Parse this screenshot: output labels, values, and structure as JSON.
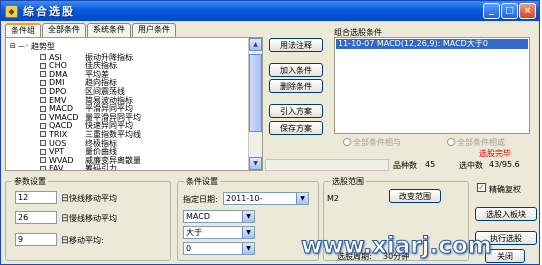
{
  "window": {
    "title": "综合选股",
    "min": "_",
    "max": "□",
    "close": "×"
  },
  "tabs": [
    "条件组",
    "全部条件",
    "系统条件",
    "用户条件"
  ],
  "tree": {
    "root": "趋势型",
    "items": [
      {
        "code": "ASI",
        "name": "振动升降指标"
      },
      {
        "code": "CHO",
        "name": "佳庆指标"
      },
      {
        "code": "DMA",
        "name": "平均差"
      },
      {
        "code": "DMI",
        "name": "趋向指标"
      },
      {
        "code": "DPO",
        "name": "区间震荡线"
      },
      {
        "code": "EMV",
        "name": "简易波动指标"
      },
      {
        "code": "MACD",
        "name": "平滑异同平均"
      },
      {
        "code": "VMACD",
        "name": "量平滑异同平均"
      },
      {
        "code": "QACD",
        "name": "快速异同平均"
      },
      {
        "code": "TRIX",
        "name": "三重指数平均线"
      },
      {
        "code": "UOS",
        "name": "终极指标"
      },
      {
        "code": "VPT",
        "name": "量价曲线"
      },
      {
        "code": "WVAD",
        "name": "威廉变异离散量"
      },
      {
        "code": "FAV",
        "name": "筹码引力"
      }
    ]
  },
  "buttons": {
    "help": "用法注释",
    "add": "加入条件",
    "delete": "删除条件",
    "import": "引入方案",
    "save": "保存方案",
    "modify_range": "改变范围",
    "add_to_block": "选股入板块",
    "execute": "执行选股",
    "close": "关闭"
  },
  "combo": {
    "title": "组合选股条件",
    "items": [
      "11-10-07 MACD(12,26,9): MACD大于0"
    ],
    "radio_all": "全部条件相与",
    "radio_any": "全部条件相或",
    "status": "选股完毕",
    "count_label": "品种数",
    "count_value": "45",
    "hit_label": "选中数",
    "hit_value": "43/95.6"
  },
  "params": {
    "title": "参数设置",
    "rows": [
      {
        "value": "12",
        "label": "日快线移动平均"
      },
      {
        "value": "26",
        "label": "日慢线移动平均"
      },
      {
        "value": "9",
        "label": "日移动平均:"
      }
    ]
  },
  "conditions": {
    "title": "条件设置",
    "date_label": "指定日期:",
    "date_value": "2011-10-",
    "indicator": "MACD",
    "operator": "大于",
    "value": "0"
  },
  "range": {
    "title": "选股范围",
    "value": "M2",
    "period_label": "选股周期:",
    "period_value": "30分钟"
  },
  "rights": {
    "label": "精确复权",
    "checked": "✓"
  },
  "watermark": "www.xiarj.com"
}
